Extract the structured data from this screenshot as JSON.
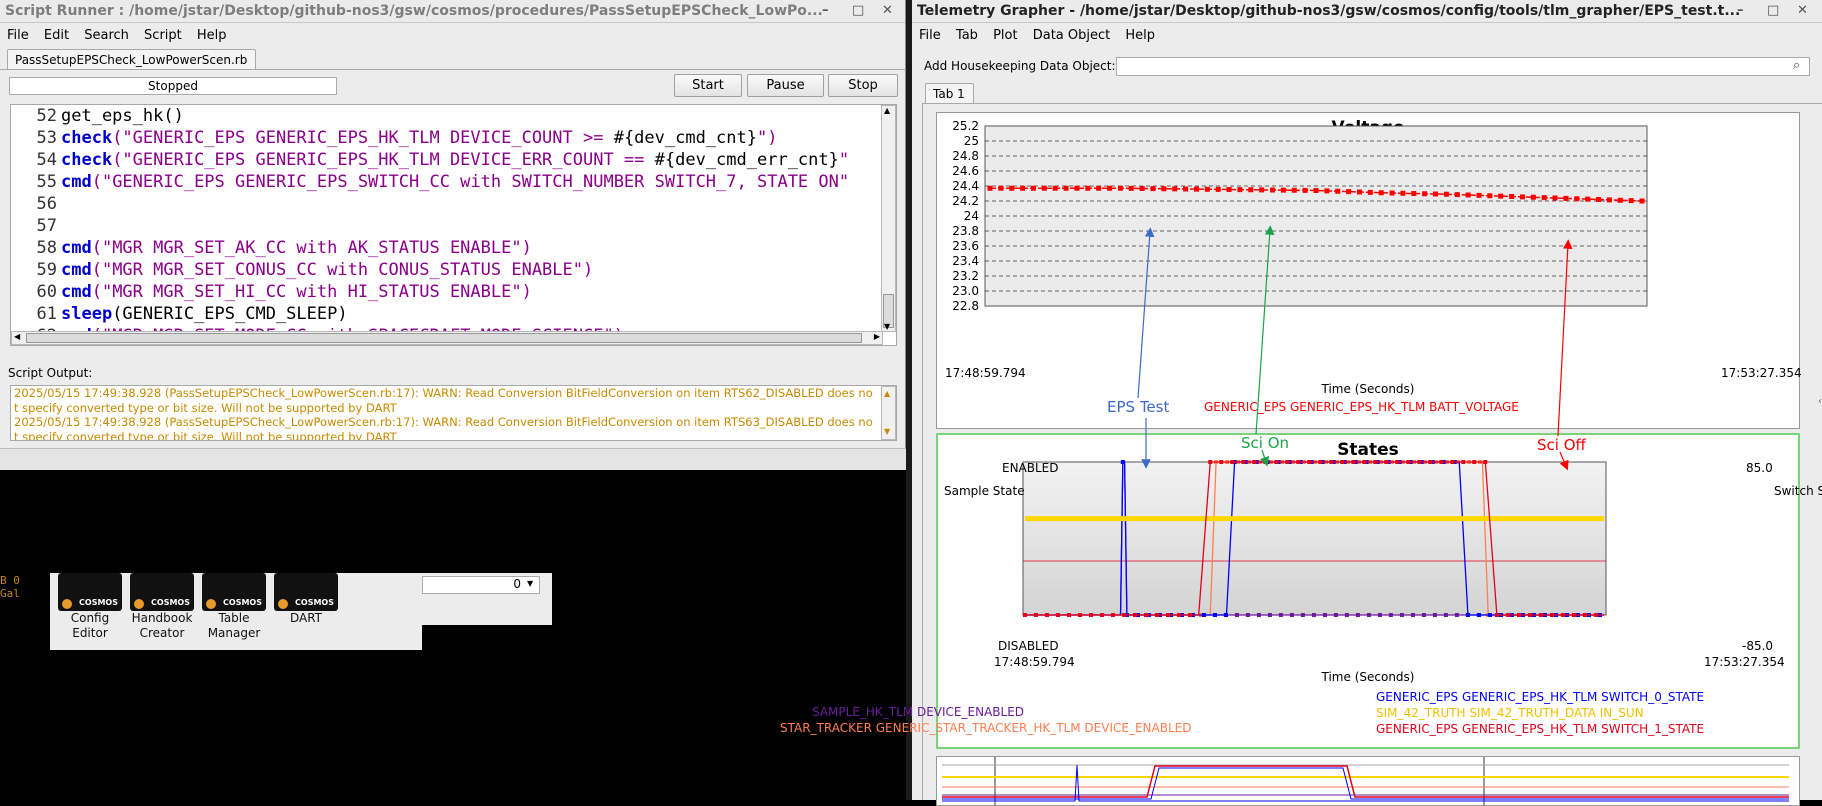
{
  "script_runner": {
    "title": "Script Runner : /home/jstar/Desktop/github-nos3/gsw/cosmos/procedures/PassSetupEPSCheck_LowPo...",
    "win_controls": [
      "–",
      "□",
      "✕"
    ],
    "menu": [
      "File",
      "Edit",
      "Search",
      "Script",
      "Help"
    ],
    "file_tab": "PassSetupEPSCheck_LowPowerScen.rb",
    "status": "Stopped",
    "buttons": {
      "start": "Start",
      "pause": "Pause",
      "stop": "Stop"
    },
    "code_lines": [
      {
        "num": "52",
        "parts": [
          {
            "t": "get_eps_hk()",
            "c": "plain"
          }
        ]
      },
      {
        "num": "53",
        "parts": [
          {
            "t": "check",
            "c": "kw"
          },
          {
            "t": "(\"GENERIC_EPS GENERIC_EPS_HK_TLM DEVICE_COUNT >= ",
            "c": "st"
          },
          {
            "t": "#{dev_cmd_cnt}",
            "c": "plain"
          },
          {
            "t": "\")",
            "c": "st"
          }
        ]
      },
      {
        "num": "54",
        "parts": [
          {
            "t": "check",
            "c": "kw"
          },
          {
            "t": "(\"GENERIC_EPS GENERIC_EPS_HK_TLM DEVICE_ERR_COUNT == ",
            "c": "st"
          },
          {
            "t": "#{dev_cmd_err_cnt}",
            "c": "plain"
          },
          {
            "t": "\"",
            "c": "st"
          }
        ]
      },
      {
        "num": "55",
        "parts": [
          {
            "t": "cmd",
            "c": "kw"
          },
          {
            "t": "(\"GENERIC_EPS GENERIC_EPS_SWITCH_CC with SWITCH_NUMBER SWITCH_7, STATE ON\"",
            "c": "st"
          }
        ]
      },
      {
        "num": "56",
        "parts": []
      },
      {
        "num": "57",
        "parts": []
      },
      {
        "num": "58",
        "parts": [
          {
            "t": "cmd",
            "c": "kw"
          },
          {
            "t": "(\"MGR MGR_SET_AK_CC with AK_STATUS ENABLE\")",
            "c": "st"
          }
        ]
      },
      {
        "num": "59",
        "parts": [
          {
            "t": "cmd",
            "c": "kw"
          },
          {
            "t": "(\"MGR MGR_SET_CONUS_CC with CONUS_STATUS ENABLE\")",
            "c": "st"
          }
        ]
      },
      {
        "num": "60",
        "parts": [
          {
            "t": "cmd",
            "c": "kw"
          },
          {
            "t": "(\"MGR MGR_SET_HI_CC with HI_STATUS ENABLE\")",
            "c": "st"
          }
        ]
      },
      {
        "num": "61",
        "parts": [
          {
            "t": "sleep",
            "c": "kw"
          },
          {
            "t": "(GENERIC_EPS_CMD_SLEEP)",
            "c": "plain"
          }
        ]
      },
      {
        "num": "62",
        "parts": [
          {
            "t": "cmd",
            "c": "kw"
          },
          {
            "t": "(\"MGR MGR_SET_MODE_CC with SPACECRAFT_MODE SCIENCE\")",
            "c": "st"
          }
        ]
      }
    ],
    "output_label": "Script Output:",
    "output_lines": [
      "2025/05/15 17:49:38.928 (PassSetupEPSCheck_LowPowerScen.rb:17): WARN: Read Conversion BitFieldConversion on item RTS62_DISABLED does not specify converted type or bit size. Will not be supported by DART",
      "2025/05/15 17:49:38.928 (PassSetupEPSCheck_LowPowerScen.rb:17): WARN: Read Conversion BitFieldConversion on item RTS63_DISABLED does not specify converted type or bit size. Will not be supported by DART"
    ]
  },
  "launcher": {
    "apps": [
      {
        "label1": "Config",
        "label2": "Editor"
      },
      {
        "label1": "Handbook",
        "label2": "Creator"
      },
      {
        "label1": "Table",
        "label2": "Manager"
      },
      {
        "label1": "DART",
        "label2": ""
      }
    ],
    "badge": "COSMOS",
    "spin_value": "0",
    "left_text": [
      "B 0",
      "Gal"
    ]
  },
  "grapher": {
    "title": "Telemetry Grapher - /home/jstar/Desktop/github-nos3/gsw/cosmos/config/tools/tlm_grapher/EPS_test.t...",
    "win_controls": [
      "–",
      "□",
      "✕"
    ],
    "menu": [
      "File",
      "Tab",
      "Plot",
      "Data Object",
      "Help"
    ],
    "add_label": "Add Housekeeping Data Object:",
    "add_value": "",
    "tab": "Tab 1"
  },
  "annotations": {
    "eps_test": "EPS Test",
    "sci_on": "Sci On",
    "sci_off": "Sci Off"
  },
  "chart_data": [
    {
      "type": "line",
      "title": "Voltage",
      "xlabel": "Time (Seconds)",
      "x_ticks": [
        "17:48:59.794",
        "17:53:27.354"
      ],
      "y_ticks": [
        "25.2",
        "25",
        "24.8",
        "24.6",
        "24.4",
        "24.2",
        "24",
        "23.8",
        "23.6",
        "23.4",
        "23.2",
        "23.0",
        "22.8"
      ],
      "ylim": [
        22.8,
        25.2
      ],
      "grid": true,
      "series": [
        {
          "name": "GENERIC_EPS GENERIC_EPS_HK_TLM BATT_VOLTAGE",
          "color": "#ff0000",
          "x_frac": [
            0,
            0.1,
            0.2,
            0.3,
            0.4,
            0.5,
            0.6,
            0.7,
            0.8,
            0.9,
            1.0
          ],
          "values": [
            24.37,
            24.37,
            24.37,
            24.36,
            24.35,
            24.34,
            24.31,
            24.29,
            24.26,
            24.23,
            24.2
          ]
        }
      ]
    },
    {
      "type": "line",
      "title": "States",
      "xlabel": "Time (Seconds)",
      "x_ticks": [
        "17:48:59.794",
        "17:53:27.354"
      ],
      "y_left_ticks": [
        "ENABLED",
        "DISABLED"
      ],
      "y_right_ticks": [
        "85.0",
        "-85.0"
      ],
      "y_left_label": "Sample State",
      "y_right_label": "Switch State",
      "series": [
        {
          "name": "SAMPLE_HK_TLM DEVICE_ENABLED",
          "color": "#6a1b9a",
          "legend_pos": "bottom-left",
          "x_frac": [
            0,
            0.165,
            0.169,
            0.172,
            0.176,
            1.0
          ],
          "values": [
            0,
            0,
            1,
            1,
            0,
            0
          ]
        },
        {
          "name": "STAR_TRACKER GENERIC_STAR_TRACKER_HK_TLM DEVICE_ENABLED",
          "color": "#ff7f50",
          "legend_pos": "bottom-left",
          "x_frac": [
            0,
            0.32,
            0.33,
            0.79,
            0.8,
            1.0
          ],
          "values": [
            0,
            0,
            1,
            1,
            0,
            0
          ]
        },
        {
          "name": "GENERIC_EPS GENERIC_EPS_HK_TLM SWITCH_0_STATE",
          "color": "#0000ff",
          "legend_pos": "bottom-right",
          "x_frac": [
            0,
            0.165,
            0.169,
            0.172,
            0.176,
            0.348,
            0.362,
            0.75,
            0.765,
            1.0
          ],
          "values": [
            0,
            0,
            1,
            1,
            0,
            0,
            1,
            1,
            0,
            0
          ]
        },
        {
          "name": "SIM_42_TRUTH SIM_42_TRUTH_DATA IN_SUN",
          "color": "#ffd700",
          "legend_pos": "bottom-right",
          "x_frac": [
            0,
            1.0
          ],
          "values": [
            0.63,
            0.63
          ]
        },
        {
          "name": "GENERIC_EPS GENERIC_EPS_HK_TLM SWITCH_1_STATE",
          "color": "#e3001b",
          "legend_pos": "bottom-right",
          "x_frac": [
            0,
            0.3,
            0.32,
            0.795,
            0.815,
            1.0
          ],
          "values": [
            0,
            0,
            1,
            1,
            0,
            0
          ]
        }
      ]
    }
  ]
}
